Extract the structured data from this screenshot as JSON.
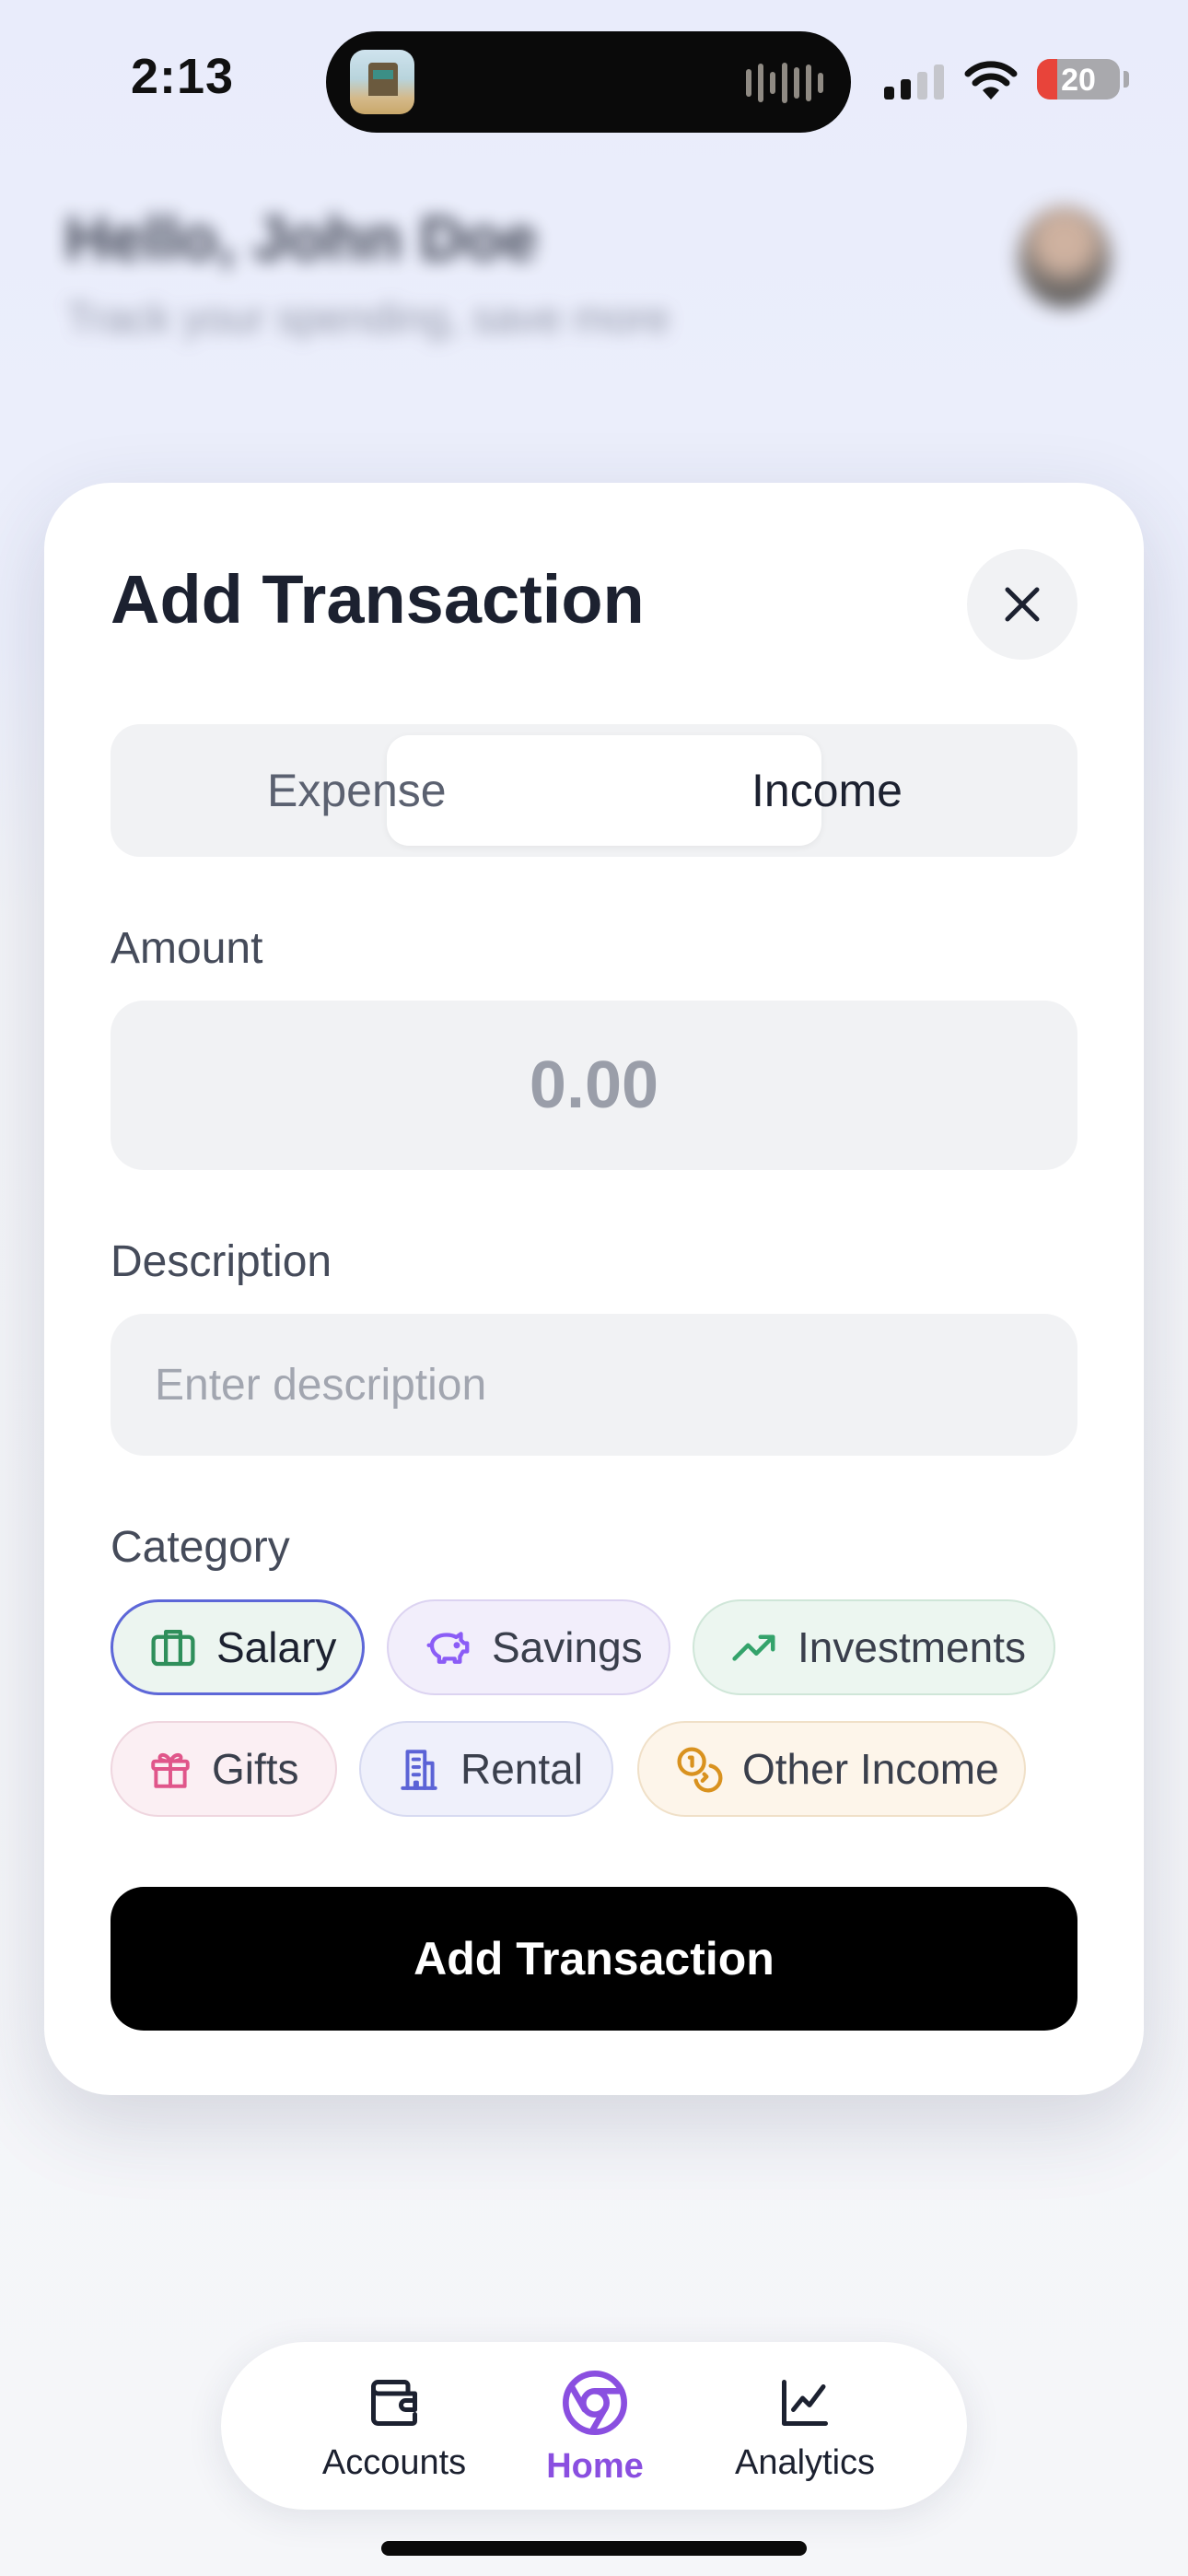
{
  "status_bar": {
    "time": "2:13",
    "battery": "20"
  },
  "background": {
    "greeting": "Hello, John Doe",
    "subtitle": "Track your spending, save more"
  },
  "modal": {
    "title": "Add Transaction",
    "type_toggle": {
      "options": [
        "Expense",
        "Income"
      ],
      "selected": "Income"
    },
    "amount": {
      "label": "Amount",
      "placeholder": "0.00"
    },
    "description": {
      "label": "Description",
      "placeholder": "Enter description"
    },
    "category": {
      "label": "Category",
      "selected": "Salary",
      "chips": [
        {
          "label": "Salary",
          "icon": "briefcase-icon",
          "color": "#2f8f5b"
        },
        {
          "label": "Savings",
          "icon": "piggy-bank-icon",
          "color": "#8b5cf6"
        },
        {
          "label": "Investments",
          "icon": "trending-up-icon",
          "color": "#34a36b"
        },
        {
          "label": "Gifts",
          "icon": "gift-icon",
          "color": "#e0568a"
        },
        {
          "label": "Rental",
          "icon": "building-icon",
          "color": "#5b63d6"
        },
        {
          "label": "Other Income",
          "icon": "coins-icon",
          "color": "#d9921f"
        }
      ]
    },
    "submit_label": "Add Transaction"
  },
  "nav": {
    "active": "Home",
    "accent": "#8a4fe0",
    "items": [
      {
        "label": "Accounts",
        "icon": "wallet-icon"
      },
      {
        "label": "Home",
        "icon": "home-ring-icon"
      },
      {
        "label": "Analytics",
        "icon": "line-chart-icon"
      }
    ]
  }
}
